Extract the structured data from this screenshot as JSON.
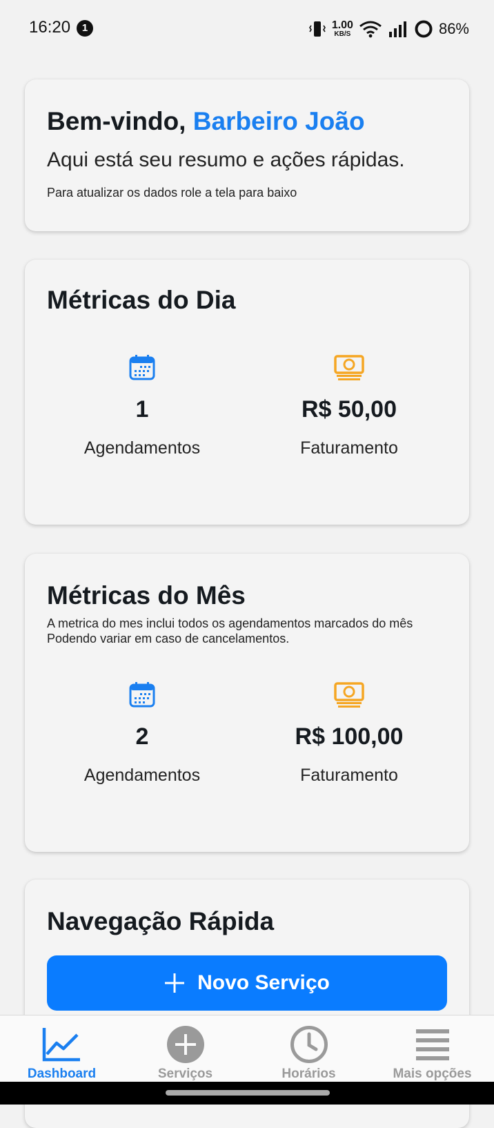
{
  "status_bar": {
    "time": "16:20",
    "notification_count": "1",
    "net_speed_value": "1.00",
    "net_speed_unit": "KB/S",
    "battery": "86%"
  },
  "welcome": {
    "greeting": "Bem-vindo,",
    "name": "Barbeiro João",
    "subtitle": "Aqui está seu resumo e ações rápidas.",
    "hint": "Para atualizar os dados role a tela para baixo"
  },
  "metrics_day": {
    "title": "Métricas do Dia",
    "appointments_value": "1",
    "appointments_label": "Agendamentos",
    "revenue_value": "R$ 50,00",
    "revenue_label": "Faturamento"
  },
  "metrics_month": {
    "title": "Métricas do Mês",
    "description": "A metrica do mes inclui todos os agendamentos marcados do mês Podendo variar em caso de cancelamentos.",
    "appointments_value": "2",
    "appointments_label": "Agendamentos",
    "revenue_value": "R$ 100,00",
    "revenue_label": "Faturamento"
  },
  "quick_nav": {
    "title": "Navegação Rápida",
    "new_service_label": "Novo Serviço"
  },
  "bottom_nav": {
    "items": [
      {
        "label": "Dashboard",
        "icon": "chart-line-icon",
        "active": true
      },
      {
        "label": "Serviços",
        "icon": "plus-circle-icon",
        "active": false
      },
      {
        "label": "Horários",
        "icon": "clock-icon",
        "active": false
      },
      {
        "label": "Mais opções",
        "icon": "menu-icon",
        "active": false
      }
    ]
  },
  "colors": {
    "accent": "#1a7ff0",
    "primary_button": "#0a7cff",
    "money_icon": "#f5a623",
    "inactive_nav": "#9a9a9a"
  }
}
